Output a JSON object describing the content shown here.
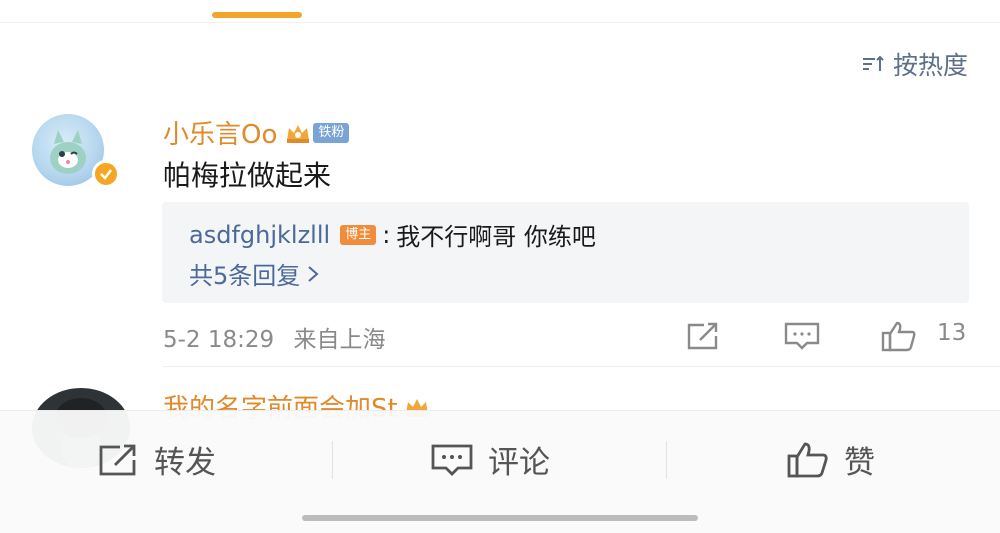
{
  "sort": {
    "label": "按热度"
  },
  "comment": {
    "username": "小乐言Oo",
    "fan_badge": "铁粉",
    "text": "帕梅拉做起来",
    "reply": {
      "author": "asdfghjklzlll",
      "author_badge": "博主",
      "separator": ":",
      "text": "我不行啊哥 你练吧",
      "more_replies": "共5条回复"
    },
    "time": "5-2 18:29",
    "location": "来自上海",
    "like_count": "13"
  },
  "next_comment": {
    "username": "我的名字前面会加St"
  },
  "bottom_bar": {
    "repost_label": "转发",
    "comment_label": "评论",
    "like_label": "赞"
  },
  "colors": {
    "accent": "#f3a52a",
    "username": "#e08a2b",
    "link": "#4b6a9a",
    "muted": "#8a8a8a"
  },
  "icons": {
    "sort": "sort-icon",
    "repost": "repost-icon",
    "comment": "comment-icon",
    "like": "thumbs-up-icon",
    "chevron": "chevron-right-icon",
    "verified": "verified-icon",
    "crown": "crown-icon"
  }
}
